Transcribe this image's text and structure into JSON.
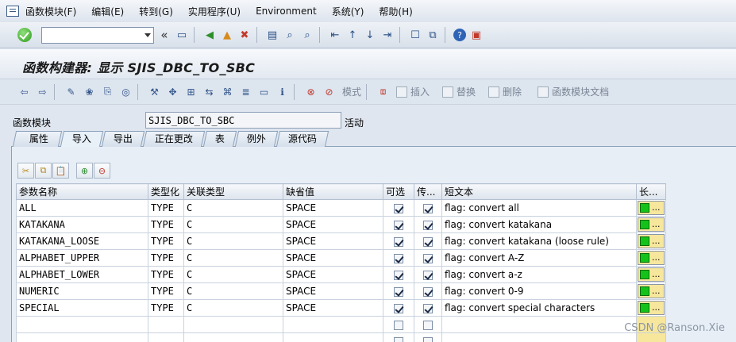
{
  "menu": [
    "函数模块(F)",
    "编辑(E)",
    "转到(G)",
    "实用程序(U)",
    "Environment",
    "系统(Y)",
    "帮助(H)"
  ],
  "toolbar": {
    "command_value": "",
    "back_symbol": "«"
  },
  "title": "函数构建器: 显示 SJIS_DBC_TO_SBC",
  "app_toolbar": {
    "buttons": [
      "模式",
      "插入",
      "替换",
      "删除",
      "函数模块文档"
    ]
  },
  "header": {
    "label": "函数模块",
    "value": "SJIS_DBC_TO_SBC",
    "status": "活动"
  },
  "tabs": [
    "属性",
    "导入",
    "导出",
    "正在更改",
    "表",
    "例外",
    "源代码"
  ],
  "grid": {
    "columns": [
      "参数名称",
      "类型化",
      "关联类型",
      "缺省值",
      "可选",
      "传...",
      "短文本",
      "长..."
    ],
    "rows": [
      {
        "name": "ALL",
        "typing": "TYPE",
        "type": "C",
        "default": "SPACE",
        "optional": true,
        "pass": true,
        "text": "flag: convert all"
      },
      {
        "name": "KATAKANA",
        "typing": "TYPE",
        "type": "C",
        "default": "SPACE",
        "optional": true,
        "pass": true,
        "text": "flag: convert katakana"
      },
      {
        "name": "KATAKANA_LOOSE",
        "typing": "TYPE",
        "type": "C",
        "default": "SPACE",
        "optional": true,
        "pass": true,
        "text": "flag: convert katakana (loose rule)"
      },
      {
        "name": "ALPHABET_UPPER",
        "typing": "TYPE",
        "type": "C",
        "default": "SPACE",
        "optional": true,
        "pass": true,
        "text": "flag: convert A-Z"
      },
      {
        "name": "ALPHABET_LOWER",
        "typing": "TYPE",
        "type": "C",
        "default": "SPACE",
        "optional": true,
        "pass": true,
        "text": "flag: convert a-z"
      },
      {
        "name": "NUMERIC",
        "typing": "TYPE",
        "type": "C",
        "default": "SPACE",
        "optional": true,
        "pass": true,
        "text": "flag: convert 0-9"
      },
      {
        "name": "SPECIAL",
        "typing": "TYPE",
        "type": "C",
        "default": "SPACE",
        "optional": true,
        "pass": true,
        "text": "flag: convert special characters"
      }
    ],
    "long_text_label": "..."
  },
  "watermark": "CSDN @Ranson.Xie"
}
